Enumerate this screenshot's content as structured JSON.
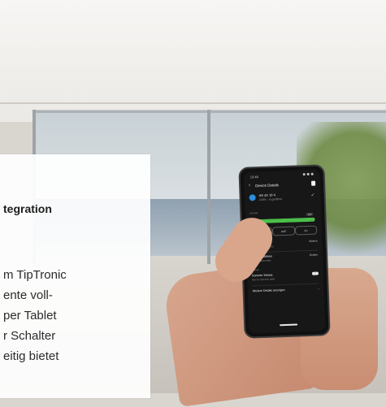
{
  "text_panel": {
    "heading": "tegration",
    "lines": [
      "m TipTronic",
      "ente voll-",
      "per Tablet",
      "r Schalter",
      "eitig bietet"
    ]
  },
  "phone": {
    "status_time": "13:48",
    "header_title": "Device Details",
    "device": {
      "name": "AS 4X 10 4",
      "status": "100% · in geöffnet"
    },
    "section_label": "Control",
    "position_readout": "100",
    "position_percent": 100,
    "buttons": [
      "0 AUS",
      "AUF",
      "ZU"
    ],
    "rows": [
      {
        "label": "Betrieb modi",
        "sub": "Normalbetrieb AUTO",
        "value": "Ändern"
      },
      {
        "label": "Timer ausführen",
        "sub": "Zeitschaltuhr aktiv",
        "value": "Ändern"
      }
    ],
    "group_label": "Sensor",
    "toggle_row": {
      "label": "Sommer Modus",
      "sub": "Nur im Sommer aktiv",
      "state": "on"
    },
    "last_row": "Weitere Details anzeigen",
    "colors": {
      "slider_fill": "#4bbf49",
      "device_icon": "#2b8ddb"
    }
  }
}
